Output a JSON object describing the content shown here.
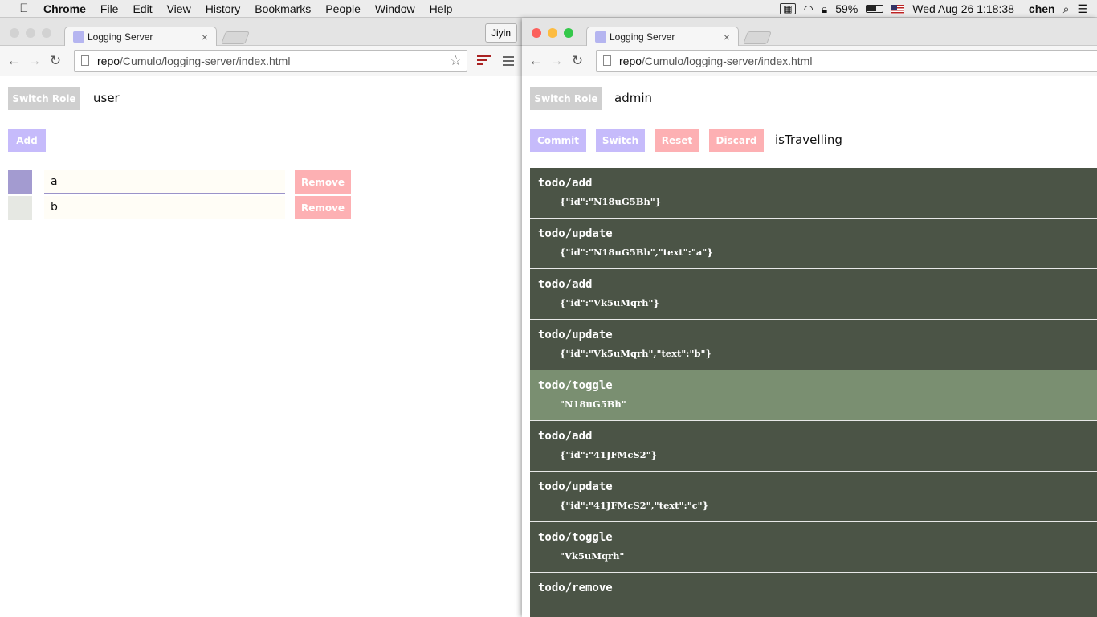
{
  "menubar": {
    "app": "Chrome",
    "items": [
      "File",
      "Edit",
      "View",
      "History",
      "Bookmarks",
      "People",
      "Window",
      "Help"
    ],
    "battery_percent": "59%",
    "battery_level": 0.59,
    "datetime": "Wed Aug 26  1:18:38",
    "user": "chen"
  },
  "left_window": {
    "tab_title": "Logging Server",
    "profile": "Jiyin",
    "url_host": "repo",
    "url_path": "/Cumulo/logging-server/index.html",
    "switch_role_label": "Switch Role",
    "role": "user",
    "add_label": "Add",
    "todos": [
      {
        "text": "a",
        "color": "#a39bd0",
        "remove_label": "Remove"
      },
      {
        "text": "b",
        "color": "#e6e8e3",
        "remove_label": "Remove"
      }
    ]
  },
  "right_window": {
    "tab_title": "Logging Server",
    "url_host": "repo",
    "url_path": "/Cumulo/logging-server/index.html",
    "switch_role_label": "Switch Role",
    "role": "admin",
    "actions": {
      "commit": "Commit",
      "switch": "Switch",
      "reset": "Reset",
      "discard": "Discard"
    },
    "status": "isTravelling",
    "log": [
      {
        "type": "todo/add",
        "payload": "{\"id\":\"N18uG5Bh\"}",
        "active": false
      },
      {
        "type": "todo/update",
        "payload": "{\"id\":\"N18uG5Bh\",\"text\":\"a\"}",
        "active": false
      },
      {
        "type": "todo/add",
        "payload": "{\"id\":\"Vk5uMqrh\"}",
        "active": false
      },
      {
        "type": "todo/update",
        "payload": "{\"id\":\"Vk5uMqrh\",\"text\":\"b\"}",
        "active": false
      },
      {
        "type": "todo/toggle",
        "payload": "\"N18uG5Bh\"",
        "active": true
      },
      {
        "type": "todo/add",
        "payload": "{\"id\":\"41JFMcS2\"}",
        "active": false
      },
      {
        "type": "todo/update",
        "payload": "{\"id\":\"41JFMcS2\",\"text\":\"c\"}",
        "active": false
      },
      {
        "type": "todo/toggle",
        "payload": "\"Vk5uMqrh\"",
        "active": false
      },
      {
        "type": "todo/remove",
        "payload": "",
        "active": false
      }
    ]
  }
}
